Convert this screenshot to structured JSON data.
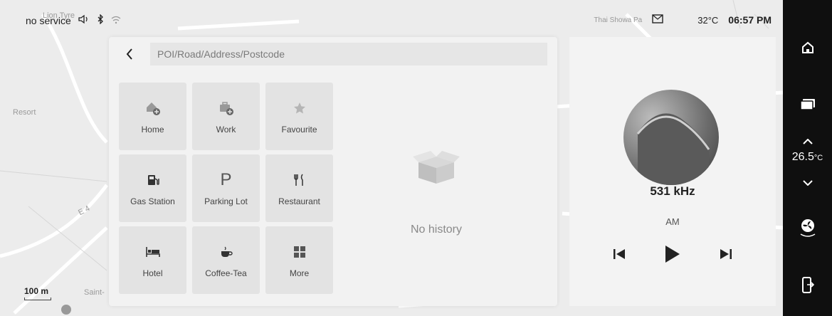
{
  "status_bar": {
    "signal": "no service",
    "place": "Thai Showa Pa",
    "temperature": "32°C",
    "time": "06:57 PM"
  },
  "map": {
    "labels": [
      "Lion Tyre",
      "Resort",
      "Saint-",
      "E 4"
    ],
    "scale": "100 m"
  },
  "search": {
    "back_icon": "back-chevron-icon",
    "placeholder": "POI/Road/Address/Postcode"
  },
  "categories": [
    {
      "label": "Home",
      "icon": "home-add-icon"
    },
    {
      "label": "Work",
      "icon": "work-add-icon"
    },
    {
      "label": "Favourite",
      "icon": "star-icon"
    },
    {
      "label": "Gas Station",
      "icon": "gas-station-icon"
    },
    {
      "label": "Parking Lot",
      "icon": "parking-icon"
    },
    {
      "label": "Restaurant",
      "icon": "restaurant-icon"
    },
    {
      "label": "Hotel",
      "icon": "hotel-icon"
    },
    {
      "label": "Coffee-Tea",
      "icon": "coffee-icon"
    },
    {
      "label": "More",
      "icon": "more-grid-icon"
    }
  ],
  "history": {
    "empty_label": "No history"
  },
  "media": {
    "frequency": "531 kHz",
    "band": "AM"
  },
  "rail": {
    "cabin_temp": "26.5",
    "temp_unit": "°C"
  }
}
